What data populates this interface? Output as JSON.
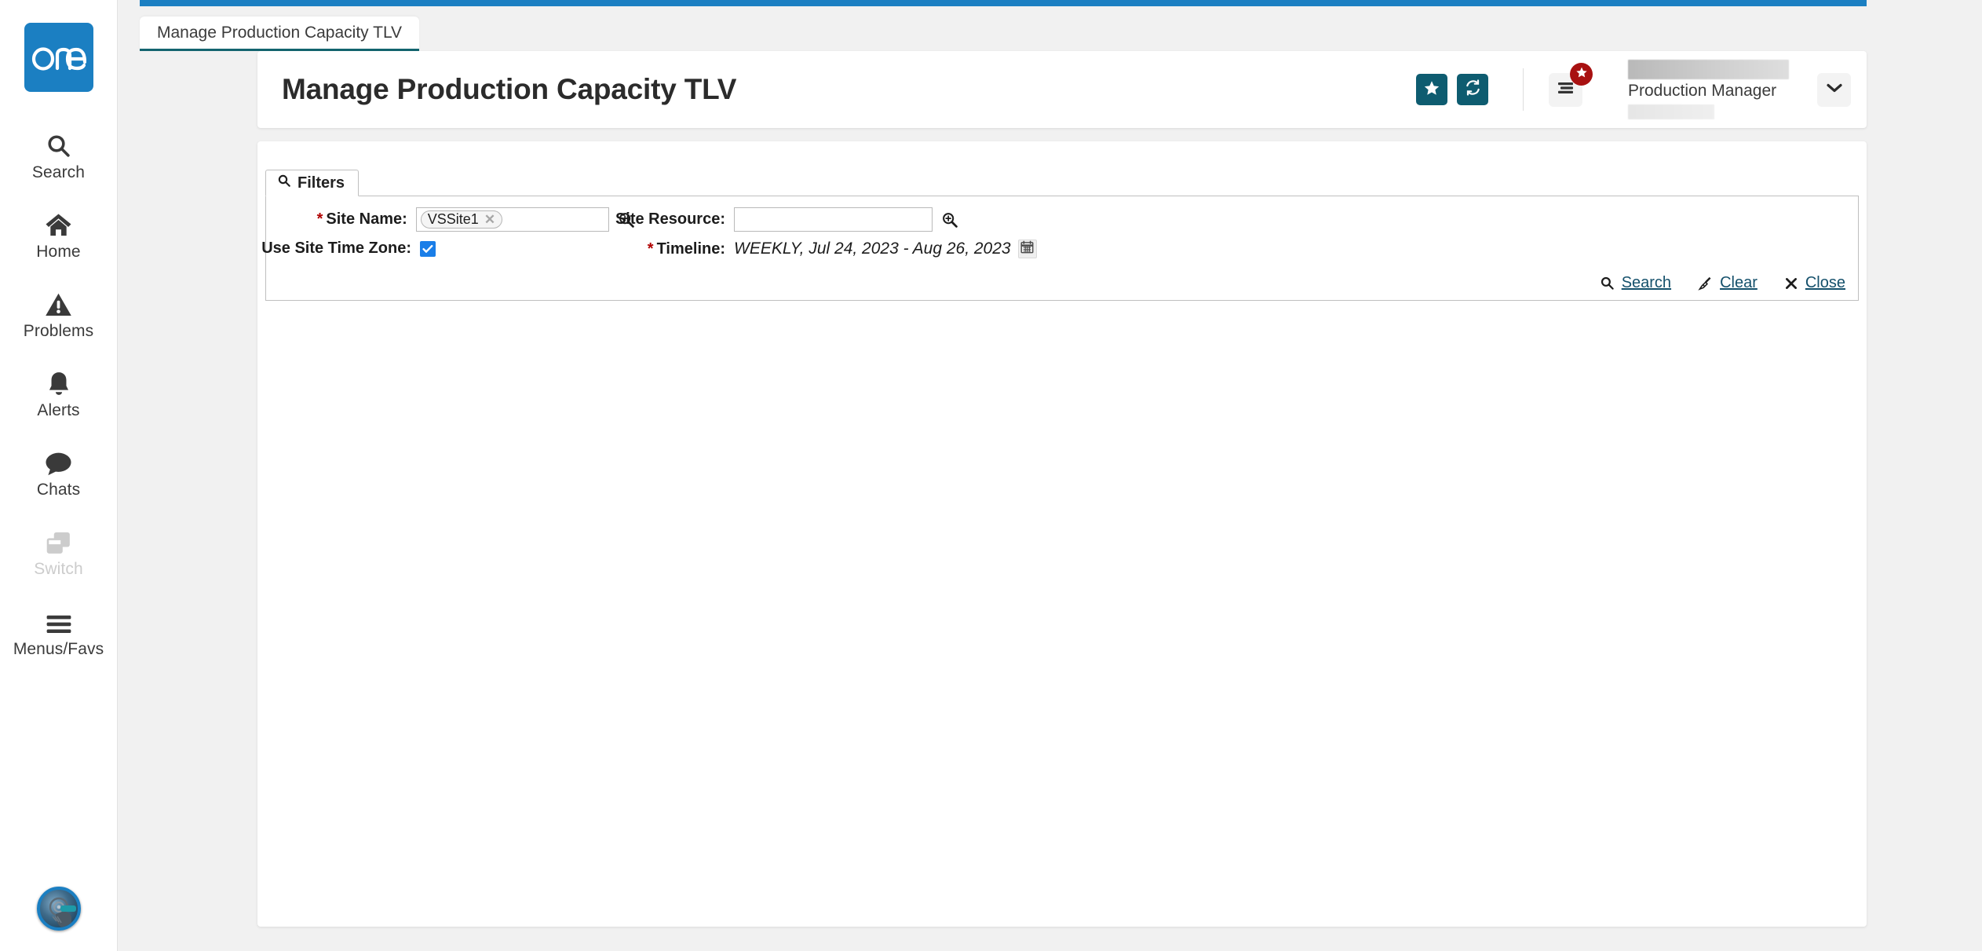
{
  "brand": {
    "logo_text": "one",
    "logo_color": "#1b7fc2"
  },
  "sidebar": {
    "items": [
      {
        "label": "Search",
        "icon": "search-icon",
        "disabled": false
      },
      {
        "label": "Home",
        "icon": "home-icon",
        "disabled": false
      },
      {
        "label": "Problems",
        "icon": "warning-icon",
        "disabled": false
      },
      {
        "label": "Alerts",
        "icon": "bell-icon",
        "disabled": false
      },
      {
        "label": "Chats",
        "icon": "chat-icon",
        "disabled": false
      },
      {
        "label": "Switch",
        "icon": "switch-icon",
        "disabled": true
      },
      {
        "label": "Menus/Favs",
        "icon": "hamburger-icon",
        "disabled": false
      }
    ],
    "avatar": {
      "icon": "user-avatar-image"
    }
  },
  "tabs": [
    {
      "label": "Manage Production Capacity TLV",
      "active": true
    }
  ],
  "header": {
    "title": "Manage Production Capacity TLV",
    "favorite_button": {
      "icon": "star-icon",
      "color": "#0e5c70"
    },
    "refresh_button": {
      "icon": "refresh-icon",
      "color": "#0e5c70"
    },
    "menu_button": {
      "icon": "menu-lines-icon",
      "badge_icon": "star-icon",
      "badge_color": "#a81111"
    },
    "user": {
      "name_redacted": true,
      "role": "Production Manager",
      "org_redacted": true
    },
    "caret_button": {
      "icon": "chevron-down-icon"
    }
  },
  "filters": {
    "tab_label": "Filters",
    "tab_icon": "search-icon",
    "fields": {
      "site_name": {
        "label": "Site Name:",
        "required": true,
        "tokens": [
          "VSSite1"
        ],
        "lookup_icon": "magnifier-plus-icon"
      },
      "site_resource": {
        "label": "Site Resource:",
        "required": false,
        "value": "",
        "placeholder": "",
        "lookup_icon": "magnifier-plus-icon"
      },
      "use_site_time_zone": {
        "label": "Use Site Time Zone:",
        "required": false,
        "checked": true,
        "check_color": "#1a7ee8"
      },
      "timeline": {
        "label": "Timeline:",
        "required": true,
        "value": "WEEKLY, Jul 24, 2023 - Aug 26, 2023",
        "calendar_icon": "calendar-icon"
      }
    },
    "actions": [
      {
        "label": "Search",
        "icon": "search-icon"
      },
      {
        "label": "Clear",
        "icon": "broom-icon"
      },
      {
        "label": "Close",
        "icon": "close-x-icon"
      }
    ]
  }
}
